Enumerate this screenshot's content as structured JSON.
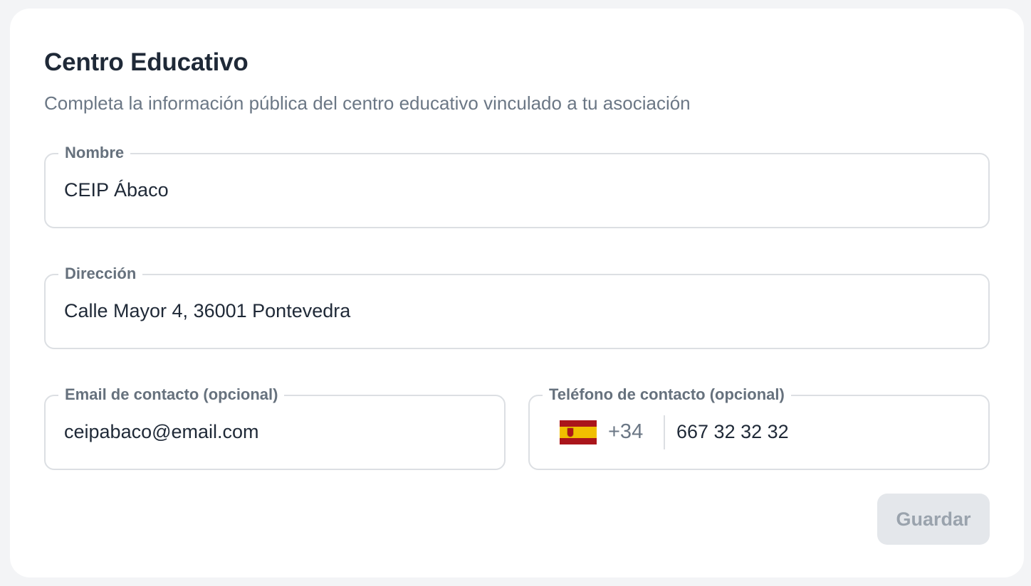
{
  "form": {
    "title": "Centro Educativo",
    "subtitle": "Completa la información pública del centro educativo vinculado a tu asociación",
    "fields": {
      "nombre": {
        "label": "Nombre",
        "value": "CEIP Ábaco"
      },
      "direccion": {
        "label": "Dirección",
        "value": "Calle Mayor 4, 36001 Pontevedra"
      },
      "email": {
        "label": "Email de contacto (opcional)",
        "value": "ceipabaco@email.com"
      },
      "telefono": {
        "label": "Teléfono de contacto (opcional)",
        "country_flag": "spain-flag-icon",
        "dial_code": "+34",
        "value": "667 32 32 32"
      }
    },
    "save_label": "Guardar",
    "save_enabled": false
  },
  "colors": {
    "page_background": "#f3f4f6",
    "card_background": "#ffffff",
    "title_text": "#1f2937",
    "muted_text": "#6b7785",
    "border": "#dcdfe3",
    "button_disabled_bg": "#e4e7eb",
    "button_disabled_text": "#9aa3ad"
  }
}
